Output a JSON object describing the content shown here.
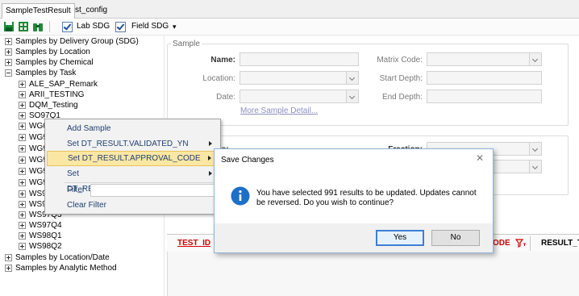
{
  "tabs": [
    {
      "label": "SampleTestResult"
    },
    {
      "label": "st_config"
    }
  ],
  "toolbar": {
    "icons": [
      "save-icon",
      "grid-icon",
      "binoculars-icon"
    ],
    "lab_sdg_label": "Lab SDG",
    "field_sdg_label": "Field SDG",
    "lab_sdg_checked": true,
    "field_sdg_checked": true
  },
  "tree": {
    "roots": [
      "Samples by Delivery Group (SDG)",
      "Samples by Location",
      "Samples by Chemical",
      "Samples by Task"
    ],
    "task_children": [
      "ALE_SAP_Remark",
      "ARII_TESTING",
      "DQM_Testing",
      "SO97Q1",
      "WG0",
      "WG9",
      "WG9",
      "WG9",
      "WG9",
      "WG9",
      "WS9",
      "WS97Q2",
      "WS97Q3",
      "WS97Q4",
      "WS98Q1",
      "WS98Q2"
    ],
    "bottom_roots": [
      "Samples by Location/Date",
      "Samples by Analytic Method"
    ]
  },
  "sample_panel": {
    "title": "Sample",
    "name_label": "Name:",
    "location_label": "Location:",
    "date_label": "Date:",
    "matrix_label": "Matrix Code:",
    "start_depth_label": "Start Depth:",
    "end_depth_label": "End Depth:",
    "more_link": "More Sample Detail..."
  },
  "filter_panel": {
    "partial_label_left": "is:",
    "fraction_label": "Fraction:"
  },
  "grid": {
    "col_test_id": "TEST_ID",
    "col_code_partial": "ODE",
    "col_result_partial": "RESULT_T",
    "accent_color": "#d40000"
  },
  "context_menu": {
    "items": [
      {
        "label": "Add Sample",
        "submenu": false
      },
      {
        "label": "Set DT_RESULT.VALIDATED_YN",
        "submenu": true
      },
      {
        "label": "Set DT_RESULT.APPROVAL_CODE",
        "submenu": true,
        "highlighted": true
      },
      {
        "label": "Set DT_RESULT.REPORTABLE_RESULT",
        "submenu": true
      }
    ],
    "filter_label": "Filter",
    "clear_filter_label": "Clear Filter"
  },
  "dialog": {
    "title": "Save Changes",
    "message_line1": "You have selected 991 results to be updated. Updates cannot",
    "message_line2": "be reversed. Do you wish to continue?",
    "yes_label": "Yes",
    "no_label": "No",
    "icon": "info-icon",
    "close_icon": "close-icon"
  }
}
